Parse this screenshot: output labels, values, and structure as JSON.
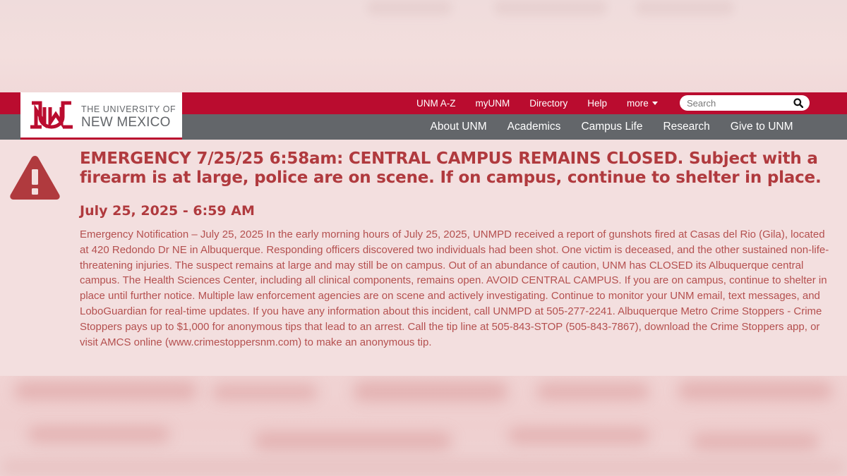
{
  "logo": {
    "line1": "THE UNIVERSITY OF",
    "line2": "NEW MEXICO"
  },
  "utility_nav": [
    "UNM A-Z",
    "myUNM",
    "Directory",
    "Help"
  ],
  "more_label": "more",
  "search": {
    "placeholder": "Search"
  },
  "main_nav": [
    "About UNM",
    "Academics",
    "Campus Life",
    "Research",
    "Give to UNM"
  ],
  "alert": {
    "title": "EMERGENCY 7/25/25 6:58am: CENTRAL CAMPUS REMAINS CLOSED. Subject with a firearm is at large, police are on scene. If on campus, continue to shelter in place.",
    "date": "July 25, 2025 - 6:59 AM",
    "body": "Emergency Notification – July 25, 2025 In the early morning hours of July 25, 2025, UNMPD received a report of gunshots fired at Casas del Rio (Gila), located at 420 Redondo Dr NE in Albuquerque. Responding officers discovered two individuals had been shot. One victim is deceased, and the other sustained non-life-threatening injuries. The suspect remains at large and may still be on campus. Out of an abundance of caution, UNM has CLOSED its Albuquerque central campus. The Health Sciences Center, including all clinical components, remains open. AVOID CENTRAL CAMPUS. If you are on campus, continue to shelter in place until further notice. Multiple law enforcement agencies are on scene and actively investigating. Continue to monitor your UNM email, text messages, and LoboGuardian for real-time updates. If you have any information about this incident, call UNMPD at 505-277-2241. Albuquerque Metro Crime Stoppers - Crime Stoppers pays up to $1,000 for anonymous tips that lead to an arrest. Call the tip line at 505-843-STOP (505-843-7867), download the Crime Stoppers app, or visit AMCS online (www.crimestoppersnm.com) to make an anonymous tip."
  },
  "colors": {
    "brand_red": "#ba0c2f",
    "nav_gray": "#63666a",
    "alert_text": "#b03a3e",
    "alert_background": "#f3dfdf"
  },
  "icons": {
    "alert": "warning-triangle-icon",
    "search": "magnifier-icon"
  }
}
